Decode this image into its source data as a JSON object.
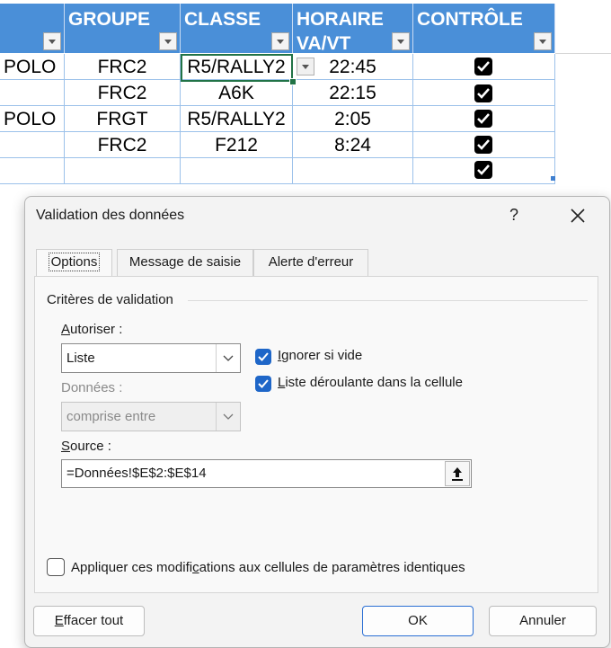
{
  "sheet": {
    "headers": {
      "groupe": "GROUPE",
      "classe": "CLASSE",
      "horaire": "HORAIRE\nVA/VT",
      "controle": "CONTRÔLE"
    },
    "rows": [
      {
        "marque": "POLO",
        "groupe": "FRC2",
        "classe": "R5/RALLY2",
        "horaire": "22:45"
      },
      {
        "marque": "",
        "groupe": "FRC2",
        "classe": "A6K",
        "horaire": "22:15"
      },
      {
        "marque": "POLO",
        "groupe": "FRGT",
        "classe": "R5/RALLY2",
        "horaire": "2:05"
      },
      {
        "marque": "",
        "groupe": "FRC2",
        "classe": "F212",
        "horaire": "8:24"
      },
      {
        "marque": "",
        "groupe": "",
        "classe": "",
        "horaire": ""
      }
    ]
  },
  "dialog": {
    "title": "Validation des données",
    "help": "?",
    "tabs": {
      "options": "Options",
      "message": "Message de saisie",
      "alerte": "Alerte d'erreur"
    },
    "group_title": "Critères de validation",
    "autoriser": {
      "prefix": "A",
      "rest": "utoriser :",
      "value": "Liste"
    },
    "donnees": {
      "label": "Données :",
      "value": "comprise entre"
    },
    "ignorer": {
      "prefix": "I",
      "rest": "gnorer si vide"
    },
    "liste_deroulante": {
      "prefix": "L",
      "rest": "iste déroulante dans la cellule"
    },
    "source": {
      "prefix": "S",
      "rest": "ource :",
      "value": "=Données!$E$2:$E$14"
    },
    "appliquer": {
      "pre": "Appliquer ces modifi",
      "u": "c",
      "post": "ations aux cellules de paramètres identiques"
    },
    "buttons": {
      "effacer_prefix": "E",
      "effacer_rest": "ffacer tout",
      "ok": "OK",
      "annuler": "Annuler"
    }
  },
  "colors": {
    "header_blue": "#4a8fd8",
    "accent": "#1e66c8",
    "selection_green": "#217346"
  }
}
